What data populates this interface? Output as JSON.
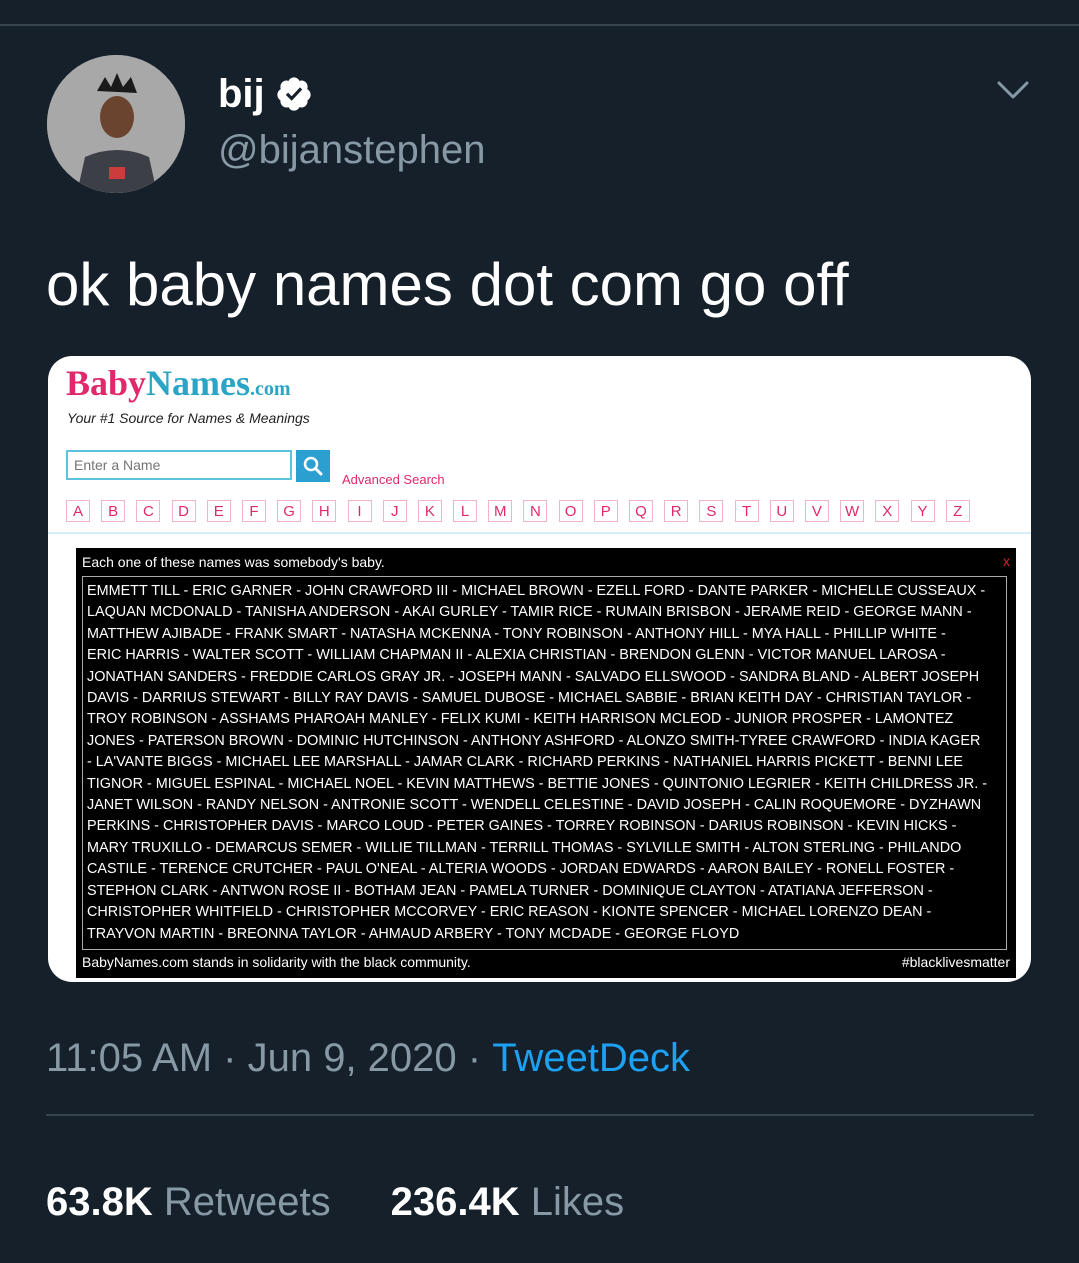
{
  "tweet": {
    "display_name": "bij",
    "handle": "@bijanstephen",
    "text": "ok baby names dot com go off",
    "time": "11:05 AM",
    "sep1": " · ",
    "date": "Jun 9, 2020",
    "sep2": " · ",
    "source": "TweetDeck",
    "retweets_count": "63.8K",
    "retweets_label": "Retweets",
    "likes_count": "236.4K",
    "likes_label": "Likes"
  },
  "embed": {
    "logo_baby": "Baby",
    "logo_names": "Names",
    "logo_com": ".com",
    "tagline": "Your #1 Source for Names & Meanings",
    "search_placeholder": "Enter a Name",
    "advanced_search": "Advanced Search",
    "letters": [
      "A",
      "B",
      "C",
      "D",
      "E",
      "F",
      "G",
      "H",
      "I",
      "J",
      "K",
      "L",
      "M",
      "N",
      "O",
      "P",
      "Q",
      "R",
      "S",
      "T",
      "U",
      "V",
      "W",
      "X",
      "Y",
      "Z"
    ],
    "memorial_title": "Each one of these names was somebody's baby.",
    "close": "x",
    "name_lines": [
      "EMMETT TILL - ERIC GARNER - JOHN CRAWFORD III - MICHAEL BROWN - EZELL FORD - DANTE PARKER - MICHELLE CUSSEAUX -",
      "LAQUAN MCDONALD - TANISHA ANDERSON - AKAI GURLEY - TAMIR RICE - RUMAIN BRISBON - JERAME REID - GEORGE MANN -",
      "MATTHEW AJIBADE - FRANK SMART - NATASHA MCKENNA - TONY ROBINSON - ANTHONY HILL - MYA HALL - PHILLIP WHITE -",
      "ERIC HARRIS - WALTER SCOTT - WILLIAM CHAPMAN II - ALEXIA CHRISTIAN - BRENDON GLENN - VICTOR MANUEL LAROSA -",
      "JONATHAN SANDERS - FREDDIE CARLOS GRAY JR. - JOSEPH MANN - SALVADO ELLSWOOD - SANDRA BLAND - ALBERT JOSEPH",
      "DAVIS - DARRIUS STEWART - BILLY RAY DAVIS - SAMUEL DUBOSE - MICHAEL SABBIE - BRIAN KEITH DAY - CHRISTIAN TAYLOR -",
      "TROY ROBINSON - ASSHAMS PHAROAH MANLEY - FELIX KUMI - KEITH HARRISON MCLEOD - JUNIOR PROSPER - LAMONTEZ",
      "JONES - PATERSON BROWN - DOMINIC HUTCHINSON - ANTHONY ASHFORD - ALONZO SMITH-TYREE CRAWFORD - INDIA KAGER",
      "- LA'VANTE BIGGS - MICHAEL LEE MARSHALL - JAMAR CLARK - RICHARD PERKINS - NATHANIEL HARRIS PICKETT - BENNI LEE",
      "TIGNOR - MIGUEL ESPINAL - MICHAEL NOEL - KEVIN MATTHEWS - BETTIE JONES - QUINTONIO LEGRIER - KEITH CHILDRESS JR. -",
      "JANET WILSON - RANDY NELSON - ANTRONIE SCOTT - WENDELL CELESTINE - DAVID JOSEPH - CALIN ROQUEMORE - DYZHAWN",
      "PERKINS - CHRISTOPHER DAVIS - MARCO LOUD - PETER GAINES - TORREY ROBINSON - DARIUS ROBINSON - KEVIN HICKS -",
      "MARY TRUXILLO - DEMARCUS SEMER - WILLIE TILLMAN - TERRILL THOMAS - SYLVILLE SMITH - ALTON STERLING - PHILANDO",
      "CASTILE - TERENCE CRUTCHER - PAUL O'NEAL - ALTERIA WOODS - JORDAN EDWARDS - AARON BAILEY - RONELL FOSTER -",
      "STEPHON CLARK - ANTWON ROSE II - BOTHAM JEAN - PAMELA TURNER - DOMINIQUE CLAYTON - ATATIANA JEFFERSON -",
      "CHRISTOPHER WHITFIELD - CHRISTOPHER MCCORVEY - ERIC REASON - KIONTE SPENCER - MICHAEL LORENZO DEAN -",
      "TRAYVON MARTIN - BREONNA TAYLOR - AHMAUD ARBERY - TONY MCDADE - GEORGE FLOYD"
    ],
    "footer_left": "BabyNames.com stands in solidarity with the black community.",
    "footer_right": "#blacklivesmatter"
  },
  "colors": {
    "background": "#15202b",
    "secondary_text": "#8899a6",
    "link": "#1da1f2",
    "brand_pink": "#e0296b",
    "brand_blue": "#2aa5c6"
  }
}
